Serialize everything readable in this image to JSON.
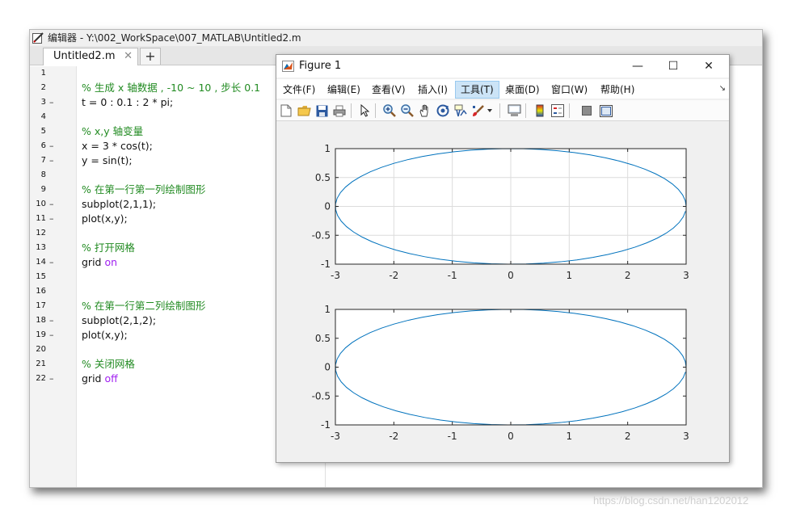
{
  "editor": {
    "title": "编辑器 - Y:\\002_WorkSpace\\007_MATLAB\\Untitled2.m",
    "tab_label": "Untitled2.m",
    "tab_close": "✕",
    "tab_add": "+",
    "lines": [
      {
        "n": "1",
        "dash": "",
        "segments": []
      },
      {
        "n": "2",
        "dash": "",
        "segments": [
          {
            "t": "% 生成 x 轴数据 , -10 ~ 10 , 步长 0.1",
            "c": "cmt"
          }
        ]
      },
      {
        "n": "3",
        "dash": "–",
        "segments": [
          {
            "t": "t = 0 : 0.1 : 2 * pi;",
            "c": ""
          }
        ]
      },
      {
        "n": "4",
        "dash": "",
        "segments": []
      },
      {
        "n": "5",
        "dash": "",
        "segments": [
          {
            "t": "% x,y 轴变量",
            "c": "cmt"
          }
        ]
      },
      {
        "n": "6",
        "dash": "–",
        "segments": [
          {
            "t": "x = 3 * cos(t);",
            "c": ""
          }
        ]
      },
      {
        "n": "7",
        "dash": "–",
        "segments": [
          {
            "t": "y = sin(t);",
            "c": ""
          }
        ]
      },
      {
        "n": "8",
        "dash": "",
        "segments": []
      },
      {
        "n": "9",
        "dash": "",
        "segments": [
          {
            "t": "% 在第一行第一列绘制图形",
            "c": "cmt"
          }
        ]
      },
      {
        "n": "10",
        "dash": "–",
        "segments": [
          {
            "t": "subplot(2,1,1);",
            "c": ""
          }
        ]
      },
      {
        "n": "11",
        "dash": "–",
        "segments": [
          {
            "t": "plot(x,y);",
            "c": ""
          }
        ]
      },
      {
        "n": "12",
        "dash": "",
        "segments": []
      },
      {
        "n": "13",
        "dash": "",
        "segments": [
          {
            "t": "% 打开网格",
            "c": "cmt"
          }
        ]
      },
      {
        "n": "14",
        "dash": "–",
        "segments": [
          {
            "t": "grid ",
            "c": ""
          },
          {
            "t": "on",
            "c": "kw"
          }
        ]
      },
      {
        "n": "15",
        "dash": "",
        "segments": []
      },
      {
        "n": "16",
        "dash": "",
        "segments": []
      },
      {
        "n": "17",
        "dash": "",
        "segments": [
          {
            "t": "% 在第一行第二列绘制图形",
            "c": "cmt"
          }
        ]
      },
      {
        "n": "18",
        "dash": "–",
        "segments": [
          {
            "t": "subplot(2,1,2);",
            "c": ""
          }
        ]
      },
      {
        "n": "19",
        "dash": "–",
        "segments": [
          {
            "t": "plot(x,y);",
            "c": ""
          }
        ]
      },
      {
        "n": "20",
        "dash": "",
        "segments": []
      },
      {
        "n": "21",
        "dash": "",
        "segments": [
          {
            "t": "% 关闭网格",
            "c": "cmt"
          }
        ]
      },
      {
        "n": "22",
        "dash": "–",
        "segments": [
          {
            "t": "grid ",
            "c": ""
          },
          {
            "t": "off",
            "c": "kw"
          }
        ]
      }
    ]
  },
  "figure": {
    "title": "Figure 1",
    "controls": {
      "minimize": "—",
      "maximize": "☐",
      "close": "✕"
    },
    "menus": [
      {
        "label": "文件(F)",
        "active": false
      },
      {
        "label": "编辑(E)",
        "active": false
      },
      {
        "label": "查看(V)",
        "active": false
      },
      {
        "label": "插入(I)",
        "active": false
      },
      {
        "label": "工具(T)",
        "active": true
      },
      {
        "label": "桌面(D)",
        "active": false
      },
      {
        "label": "窗口(W)",
        "active": false
      },
      {
        "label": "帮助(H)",
        "active": false
      }
    ],
    "menu_more": "↘",
    "toolbar_icons": [
      "new-file-icon",
      "open-folder-icon",
      "save-icon",
      "print-icon",
      "pointer-icon",
      "zoom-in-icon",
      "zoom-out-icon",
      "pan-hand-icon",
      "rotate-3d-icon",
      "data-cursor-icon",
      "brush-icon",
      "brush-dropdown-icon",
      "link-plot-icon",
      "colorbar-icon",
      "legend-icon",
      "hide-plot-tools-icon",
      "show-plot-tools-icon"
    ]
  },
  "colors": {
    "line": "#0072bd",
    "grid": "#dcdcdc",
    "comment": "#228b22",
    "keyword": "#a020f0",
    "menu_active": "#cce4f7"
  },
  "chart_data": [
    {
      "type": "line",
      "grid": true,
      "xlim": [
        -3,
        3
      ],
      "ylim": [
        -1,
        1
      ],
      "xticks": [
        "-3",
        "-2",
        "-1",
        "0",
        "1",
        "2",
        "3"
      ],
      "yticks": [
        "1",
        "0.5",
        "0",
        "-0.5",
        "-1"
      ],
      "series": [
        {
          "x_expr": "3*cos(t)",
          "y_expr": "sin(t)",
          "t_start": 0,
          "t_step": 0.1,
          "t_end": 6.2832
        }
      ]
    },
    {
      "type": "line",
      "grid": false,
      "xlim": [
        -3,
        3
      ],
      "ylim": [
        -1,
        1
      ],
      "xticks": [
        "-3",
        "-2",
        "-1",
        "0",
        "1",
        "2",
        "3"
      ],
      "yticks": [
        "1",
        "0.5",
        "0",
        "-0.5",
        "-1"
      ],
      "series": [
        {
          "x_expr": "3*cos(t)",
          "y_expr": "sin(t)",
          "t_start": 0,
          "t_step": 0.1,
          "t_end": 6.2832
        }
      ]
    }
  ],
  "watermark": "https://blog.csdn.net/han1202012"
}
